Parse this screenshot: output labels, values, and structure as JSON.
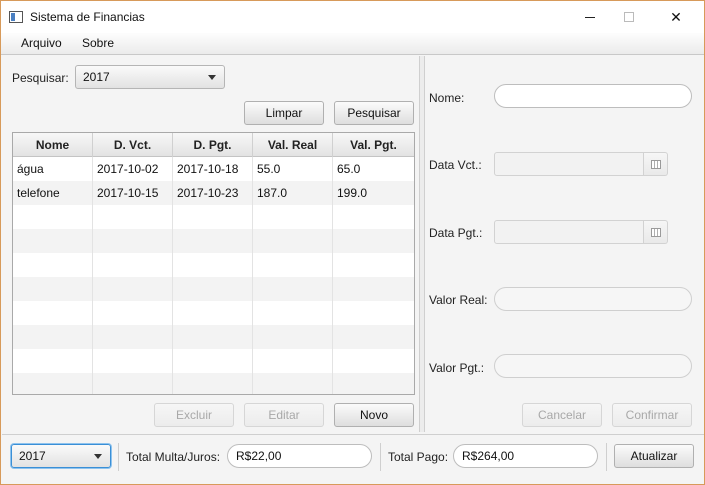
{
  "window": {
    "title": "Sistema de Financias",
    "minimize_icon": "minimize-icon",
    "maximize_icon": "maximize-icon",
    "close_icon": "close-icon",
    "close_glyph": "✕"
  },
  "menu": {
    "items": [
      {
        "label": "Arquivo"
      },
      {
        "label": "Sobre"
      }
    ]
  },
  "search": {
    "label": "Pesquisar:",
    "year_value": "2017",
    "clear_label": "Limpar",
    "search_label": "Pesquisar"
  },
  "table": {
    "columns": [
      "Nome",
      "D. Vct.",
      "D. Pgt.",
      "Val. Real",
      "Val. Pgt."
    ],
    "rows": [
      [
        "água",
        "2017-10-02",
        "2017-10-18",
        "55.0",
        "65.0"
      ],
      [
        "telefone",
        "2017-10-15",
        "2017-10-23",
        "187.0",
        "199.0"
      ]
    ]
  },
  "table_actions": {
    "delete_label": "Excluir",
    "edit_label": "Editar",
    "new_label": "Novo"
  },
  "form": {
    "name_label": "Nome:",
    "name_value": "",
    "due_date_label": "Data Vct.:",
    "due_date_value": "",
    "pay_date_label": "Data Pgt.:",
    "pay_date_value": "",
    "real_value_label": "Valor Real:",
    "real_value": "",
    "paid_value_label": "Valor Pgt.:",
    "paid_value": "",
    "cancel_label": "Cancelar",
    "confirm_label": "Confirmar"
  },
  "footer": {
    "year_value": "2017",
    "fines_label": "Total Multa/Juros:",
    "fines_value": "R$22,00",
    "paid_label": "Total Pago:",
    "paid_value": "R$264,00",
    "refresh_label": "Atualizar"
  },
  "colors": {
    "window_border": "#d79a5a",
    "focus_blue": "#3a8fd6",
    "background": "#f4f4f4"
  }
}
